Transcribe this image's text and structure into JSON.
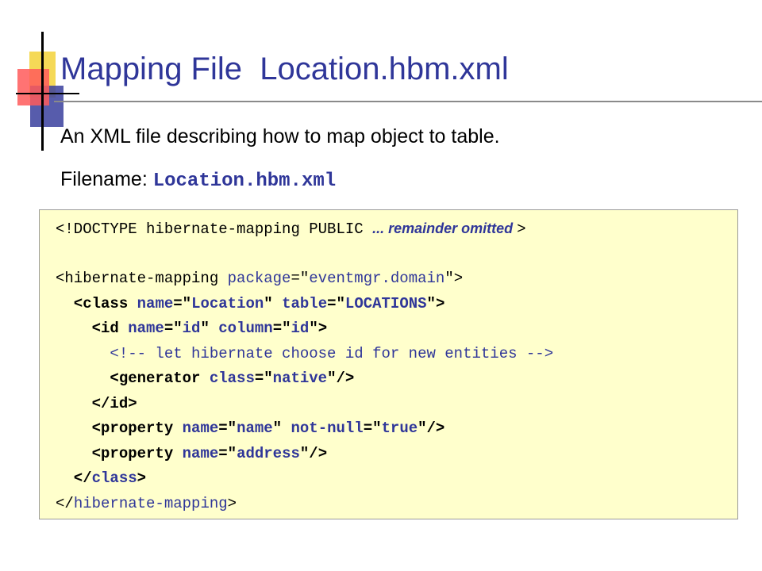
{
  "slide": {
    "title": "Mapping File  Location.hbm.xml",
    "bullets": [
      {
        "text": "An XML file describing how to map object to table."
      },
      {
        "label": "Filename: ",
        "filename": "Location.hbm.xml"
      }
    ]
  },
  "colors": {
    "title": "#2f3699",
    "code_background": "#ffffcc",
    "accent_blue": "#2f3699",
    "accent_red": "#ff5a5a",
    "accent_yellow": "#f3d23a"
  },
  "code": {
    "lines": [
      [
        {
          "t": "<!DOCTYPE hibernate-mapping PUBLIC ",
          "c": "plain"
        },
        {
          "t": "... remainder omitted ",
          "c": "note"
        },
        {
          "t": ">",
          "c": "plain"
        }
      ],
      [],
      [
        {
          "t": "<hibernate-mapping ",
          "c": "tag"
        },
        {
          "t": "package",
          "c": "attr"
        },
        {
          "t": "=\"",
          "c": "tag"
        },
        {
          "t": "eventmgr.domain",
          "c": "val"
        },
        {
          "t": "\">",
          "c": "tag"
        }
      ],
      [
        {
          "t": "  <",
          "c": "tagb"
        },
        {
          "t": "class ",
          "c": "tagb"
        },
        {
          "t": "name",
          "c": "attrb"
        },
        {
          "t": "=\"",
          "c": "tagb"
        },
        {
          "t": "Location",
          "c": "valb"
        },
        {
          "t": "\" ",
          "c": "tagb"
        },
        {
          "t": "table",
          "c": "attrb"
        },
        {
          "t": "=\"",
          "c": "tagb"
        },
        {
          "t": "LOCATIONS",
          "c": "valb"
        },
        {
          "t": "\">",
          "c": "tagb"
        }
      ],
      [
        {
          "t": "    <id ",
          "c": "tagb"
        },
        {
          "t": "name",
          "c": "attrb"
        },
        {
          "t": "=\"",
          "c": "tagb"
        },
        {
          "t": "id",
          "c": "valb"
        },
        {
          "t": "\" ",
          "c": "tagb"
        },
        {
          "t": "column",
          "c": "attrb"
        },
        {
          "t": "=\"",
          "c": "tagb"
        },
        {
          "t": "id",
          "c": "valb"
        },
        {
          "t": "\">",
          "c": "tagb"
        }
      ],
      [
        {
          "t": "      <!-- let hibernate choose id for new entities -->",
          "c": "comment"
        }
      ],
      [
        {
          "t": "      <generator ",
          "c": "tagb"
        },
        {
          "t": "class",
          "c": "attrb"
        },
        {
          "t": "=\"",
          "c": "tagb"
        },
        {
          "t": "native",
          "c": "valb"
        },
        {
          "t": "\"/>",
          "c": "tagb"
        }
      ],
      [
        {
          "t": "    </id>",
          "c": "tagb"
        }
      ],
      [
        {
          "t": "    <property ",
          "c": "tagb"
        },
        {
          "t": "name",
          "c": "attrb"
        },
        {
          "t": "=\"",
          "c": "tagb"
        },
        {
          "t": "name",
          "c": "valb"
        },
        {
          "t": "\" ",
          "c": "tagb"
        },
        {
          "t": "not-null",
          "c": "attrb"
        },
        {
          "t": "=\"",
          "c": "tagb"
        },
        {
          "t": "true",
          "c": "valb"
        },
        {
          "t": "\"/>",
          "c": "tagb"
        }
      ],
      [
        {
          "t": "    <property ",
          "c": "tagb"
        },
        {
          "t": "name",
          "c": "attrb"
        },
        {
          "t": "=\"",
          "c": "tagb"
        },
        {
          "t": "address",
          "c": "valb"
        },
        {
          "t": "\"/>",
          "c": "tagb"
        }
      ],
      [
        {
          "t": "  </",
          "c": "tagb"
        },
        {
          "t": "class",
          "c": "attrb"
        },
        {
          "t": ">",
          "c": "tagb"
        }
      ],
      [
        {
          "t": "</",
          "c": "tag"
        },
        {
          "t": "hibernate-mapping",
          "c": "attr"
        },
        {
          "t": ">",
          "c": "tag"
        }
      ]
    ]
  }
}
